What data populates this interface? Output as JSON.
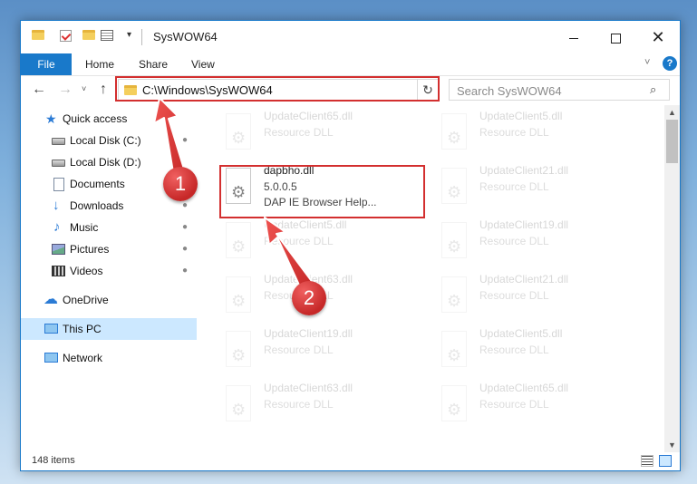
{
  "window": {
    "title": "SysWOW64",
    "quick_access_dropdown": "▾",
    "minimize": "",
    "maximize": "",
    "close": "✕"
  },
  "ribbon": {
    "file_tab": "File",
    "tabs": [
      "Home",
      "Share",
      "View"
    ],
    "help_chevron": "˅",
    "help": "?"
  },
  "navigation": {
    "back": "←",
    "forward": "→",
    "recent": "˅",
    "up": "↑",
    "address": "C:\\Windows\\SysWOW64",
    "address_dropdown": "˅",
    "refresh": "↻",
    "search_placeholder": "Search SysWOW64",
    "search_icon": "⌕"
  },
  "sidebar": {
    "items": [
      {
        "label": "Quick access",
        "icon": "star-icon",
        "pinned": false
      },
      {
        "label": "Local Disk (C:)",
        "icon": "drive-icon",
        "pinned": true
      },
      {
        "label": "Local Disk (D:)",
        "icon": "drive-icon",
        "pinned": false
      },
      {
        "label": "Documents",
        "icon": "documents-icon",
        "pinned": true
      },
      {
        "label": "Downloads",
        "icon": "downloads-icon",
        "pinned": true
      },
      {
        "label": "Music",
        "icon": "music-icon",
        "pinned": true
      },
      {
        "label": "Pictures",
        "icon": "pictures-icon",
        "pinned": true
      },
      {
        "label": "Videos",
        "icon": "videos-icon",
        "pinned": true
      },
      {
        "label": "OneDrive",
        "icon": "onedrive-icon",
        "pinned": false
      },
      {
        "label": "This PC",
        "icon": "this-pc-icon",
        "pinned": false,
        "selected": true
      },
      {
        "label": "Network",
        "icon": "network-icon",
        "pinned": false
      }
    ],
    "pin_glyph": "📌"
  },
  "files": {
    "left_column": [
      {
        "name": "UpdateClient65.dll",
        "type": "Resource DLL"
      },
      {
        "name": "dapbho.dll",
        "version": "5.0.0.5",
        "description": "DAP IE Browser Help..."
      },
      {
        "name": "UpdateClient5.dll",
        "type": "Resource DLL"
      },
      {
        "name": "UpdateClient63.dll",
        "type": "Resource DLL"
      },
      {
        "name": "UpdateClient19.dll",
        "type": "Resource DLL"
      },
      {
        "name": "UpdateClient63.dll",
        "type": "Resource DLL"
      }
    ],
    "right_column": [
      {
        "name": "UpdateClient5.dll",
        "type": "Resource DLL"
      },
      {
        "name": "UpdateClient21.dll",
        "type": "Resource DLL"
      },
      {
        "name": "UpdateClient19.dll",
        "type": "Resource DLL"
      },
      {
        "name": "UpdateClient21.dll",
        "type": "Resource DLL"
      },
      {
        "name": "UpdateClient5.dll",
        "type": "Resource DLL"
      },
      {
        "name": "UpdateClient65.dll",
        "type": "Resource DLL"
      }
    ]
  },
  "scrollbar": {
    "up": "▲",
    "down": "▼"
  },
  "status": {
    "item_count": "148 items"
  },
  "callouts": [
    "1",
    "2"
  ],
  "colors": {
    "accent": "#1979ca",
    "highlight": "#d32f2f",
    "selected": "#cce8ff"
  }
}
